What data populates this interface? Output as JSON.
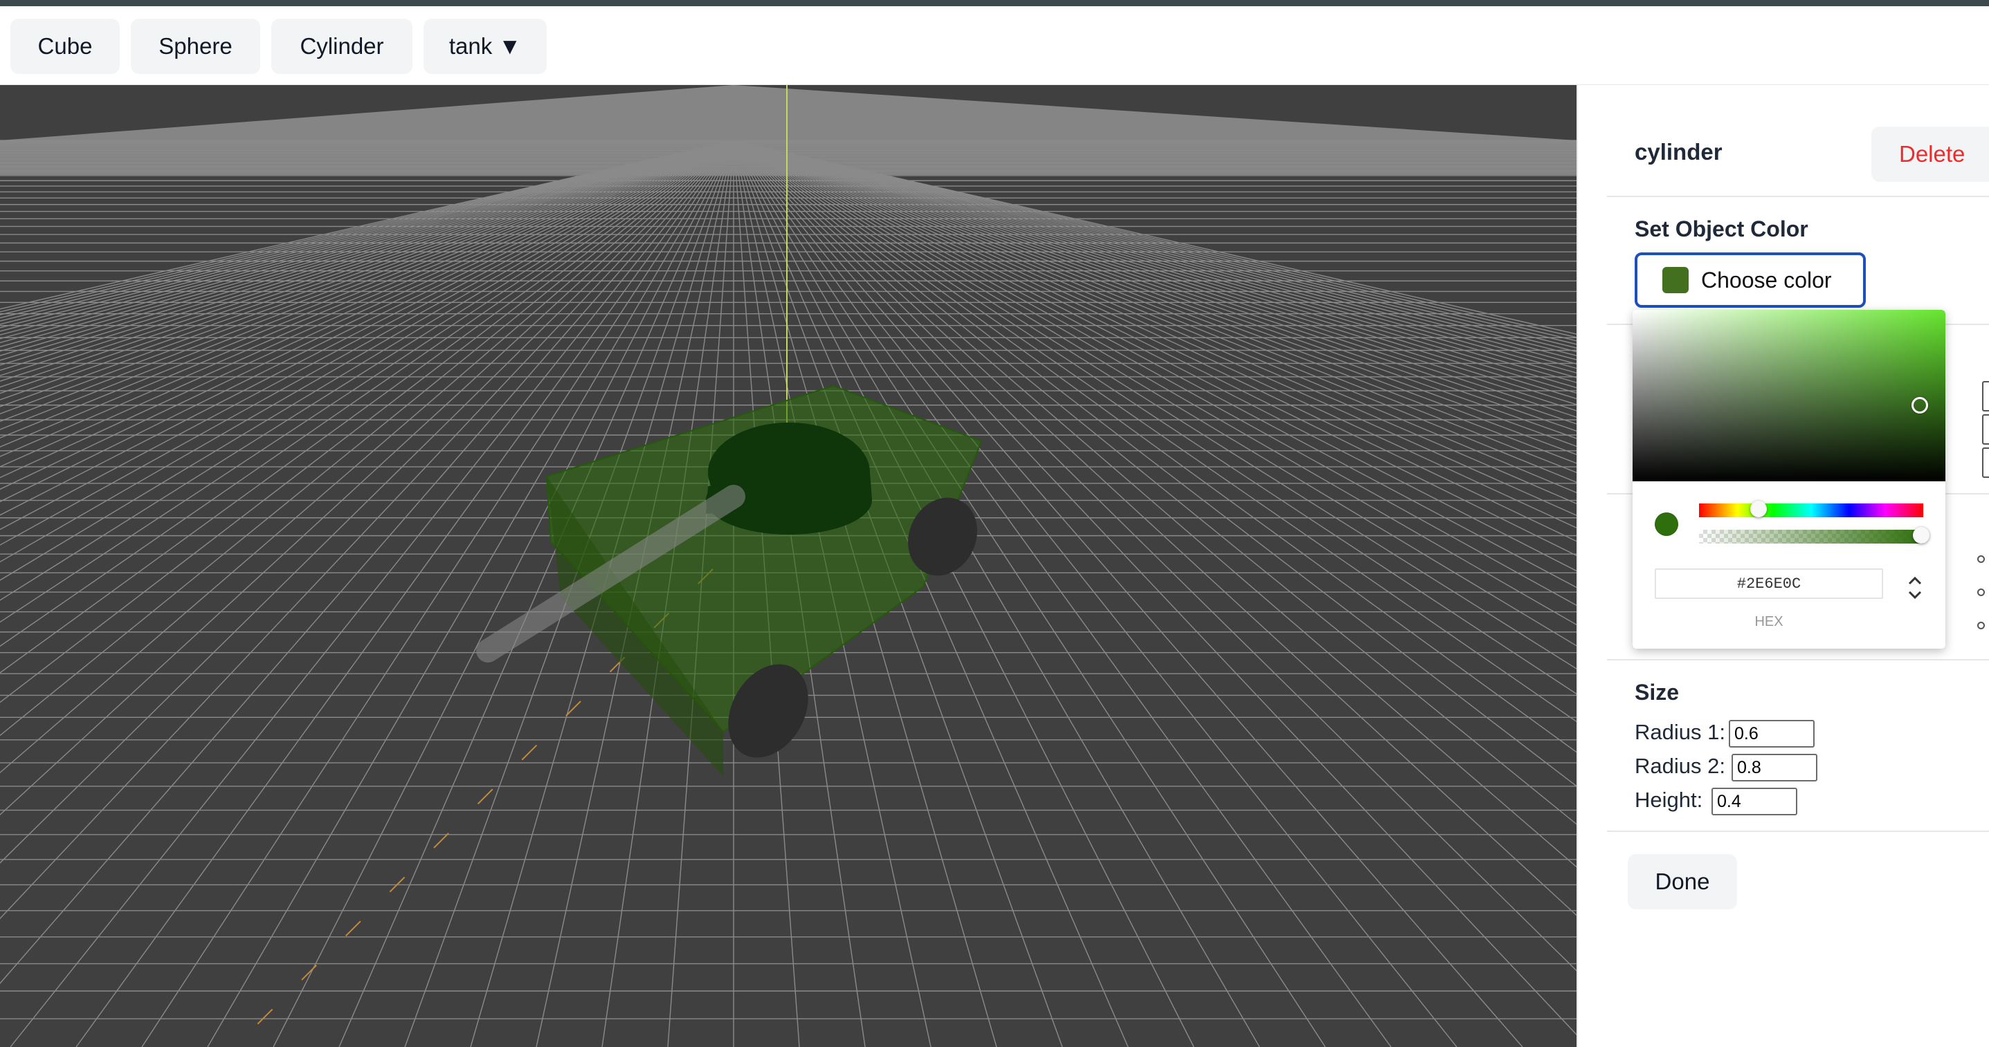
{
  "toolbar": {
    "buttons": [
      "Cube",
      "Sphere",
      "Cylinder"
    ],
    "dropdown_label": "tank ▼"
  },
  "panel": {
    "object_name": "cylinder",
    "delete_label": "Delete",
    "color_section_title": "Set Object Color",
    "choose_color_label": "Choose color",
    "selected_color": "#42701f",
    "size_section_title": "Size",
    "fields": [
      {
        "label": "Radius 1:",
        "value": "0.6"
      },
      {
        "label": "Radius 2:",
        "value": "0.8"
      },
      {
        "label": "Height:",
        "value": "0.4"
      }
    ],
    "done_label": "Done"
  },
  "color_picker": {
    "hex_value": "#2E6E0C",
    "hex_label": "HEX",
    "hue_color": "#66e52e",
    "current_color": "#2e6e0c"
  },
  "scene": {
    "background_color": "#404040",
    "grid_color": "#8a8a8a",
    "vertical_axis_color": "#c8d85a",
    "horizontal_axis_color": "#c88a2e",
    "tank_body_color": "#2e6e0c",
    "turret_color": "#0f360a",
    "barrel_color": "#6b6b6b",
    "wheel_color": "#2d2d2d"
  }
}
